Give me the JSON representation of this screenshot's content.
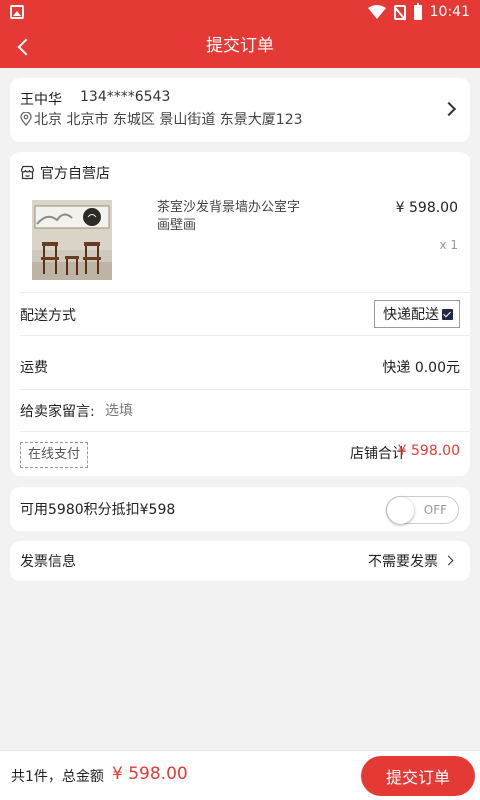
{
  "status_bar": {
    "time": "10:41",
    "icons": [
      "image-icon",
      "wifi-icon",
      "no-sim-icon",
      "battery-icon"
    ]
  },
  "nav": {
    "title": "提交订单",
    "back_icon": "chevron-left-icon"
  },
  "address": {
    "name": "王中华",
    "phone": "134****6543",
    "line": "北京 北京市 东城区 景山街道 东景大厦123"
  },
  "store": {
    "name": "官方自营店",
    "product": {
      "title": "茶室沙发背景墙办公室字画壁画",
      "price": "¥ 598.00",
      "quantity": "x 1"
    },
    "delivery": {
      "label": "配送方式",
      "option": "快递配送",
      "checked": true
    },
    "shipping_fee": {
      "label": "运费",
      "value": "快递  0.00元"
    },
    "message": {
      "label": "给卖家留言:",
      "placeholder": "选填"
    },
    "payment_tag": "在线支付",
    "total_label": "店铺合计",
    "total_value": "¥ 598.00"
  },
  "points": {
    "text": "可用5980积分抵扣¥598",
    "toggle_label": "OFF",
    "enabled": false
  },
  "invoice": {
    "label": "发票信息",
    "value": "不需要发票"
  },
  "footer": {
    "count_text": "共1件，总金额",
    "amount": "¥ 598.00",
    "submit_label": "提交订单"
  },
  "colors": {
    "accent": "#e53935",
    "background": "#f2f2f2",
    "card": "#ffffff"
  }
}
